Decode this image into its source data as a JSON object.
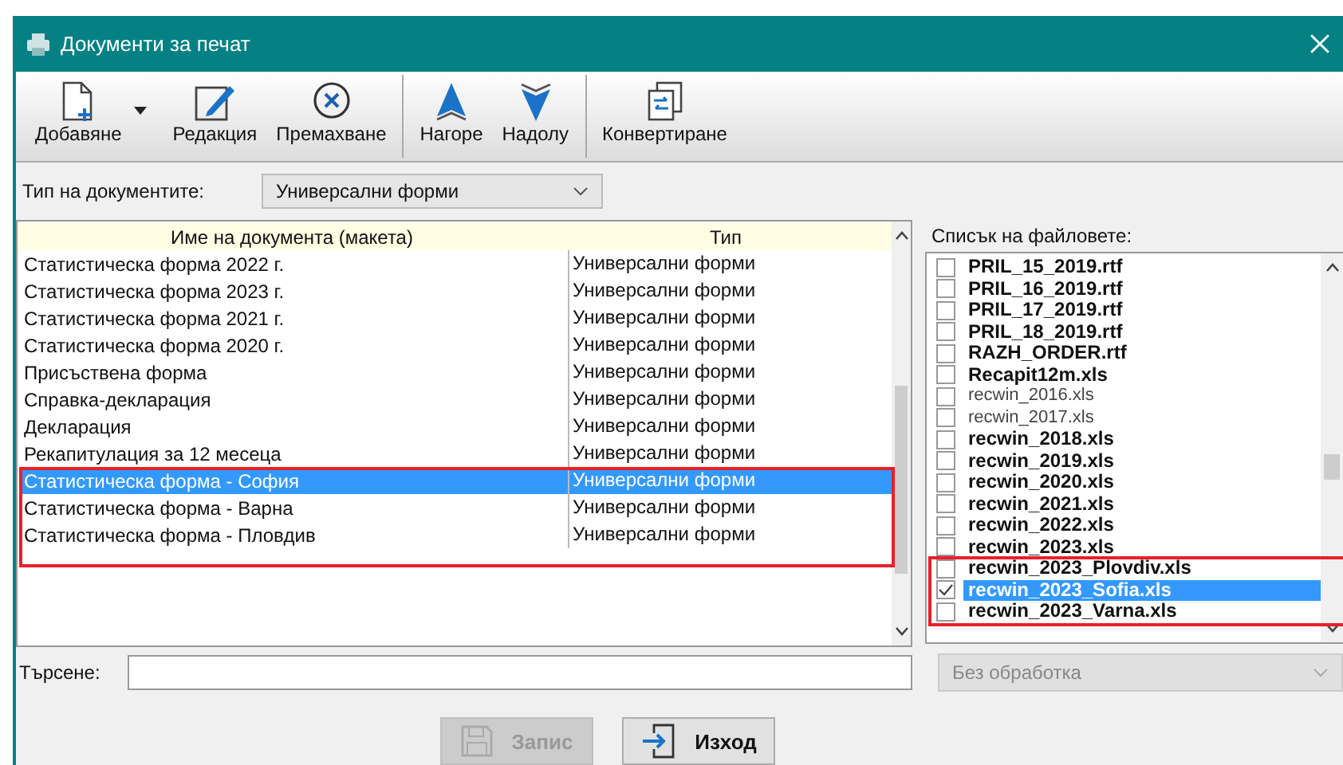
{
  "window": {
    "title": "Документи за печат"
  },
  "toolbar_groups": [
    [
      {
        "label": "Добавяне",
        "kind": "add",
        "dropdown": true
      },
      {
        "label": "Редакция",
        "kind": "edit",
        "dropdown": false
      },
      {
        "label": "Премахване",
        "kind": "remove",
        "dropdown": false
      }
    ],
    [
      {
        "label": "Нагоре",
        "kind": "up",
        "dropdown": false
      },
      {
        "label": "Надолу",
        "kind": "down",
        "dropdown": false
      }
    ],
    [
      {
        "label": "Конвертиране",
        "kind": "convert",
        "dropdown": false
      }
    ]
  ],
  "document_type": {
    "label": "Тип на документите:",
    "value": "Универсални форми"
  },
  "documents": {
    "columns": [
      "Име на документа (макета)",
      "Тип"
    ],
    "rows": [
      {
        "name": "Статистическа форма 2022 г.",
        "type": "Универсални форми",
        "selected": false,
        "highlighted": false
      },
      {
        "name": "Статистическа форма 2023 г.",
        "type": "Универсални форми",
        "selected": false,
        "highlighted": false
      },
      {
        "name": "Статистическа форма 2021 г.",
        "type": "Универсални форми",
        "selected": false,
        "highlighted": false
      },
      {
        "name": "Статистическа форма 2020 г.",
        "type": "Универсални форми",
        "selected": false,
        "highlighted": false
      },
      {
        "name": "Присъствена форма",
        "type": "Универсални форми",
        "selected": false,
        "highlighted": false
      },
      {
        "name": "Справка-декларация",
        "type": "Универсални форми",
        "selected": false,
        "highlighted": false
      },
      {
        "name": "Декларация",
        "type": "Универсални форми",
        "selected": false,
        "highlighted": false
      },
      {
        "name": "Рекапитулация за 12 месеца",
        "type": "Универсални форми",
        "selected": false,
        "highlighted": false
      },
      {
        "name": "Статистическа форма - София",
        "type": "Универсални форми",
        "selected": true,
        "highlighted": true
      },
      {
        "name": "Статистическа форма - Варна",
        "type": "Универсални форми",
        "selected": false,
        "highlighted": true
      },
      {
        "name": "Статистическа форма - Пловдив",
        "type": "Универсални форми",
        "selected": false,
        "highlighted": true
      }
    ]
  },
  "files": {
    "label": "Списък на файловете:",
    "items": [
      {
        "name": "PRIL_15_2019.rtf",
        "bold": true,
        "checked": false,
        "selected": false,
        "highlighted": false
      },
      {
        "name": "PRIL_16_2019.rtf",
        "bold": true,
        "checked": false,
        "selected": false,
        "highlighted": false
      },
      {
        "name": "PRIL_17_2019.rtf",
        "bold": true,
        "checked": false,
        "selected": false,
        "highlighted": false
      },
      {
        "name": "PRIL_18_2019.rtf",
        "bold": true,
        "checked": false,
        "selected": false,
        "highlighted": false
      },
      {
        "name": "RAZH_ORDER.rtf",
        "bold": true,
        "checked": false,
        "selected": false,
        "highlighted": false
      },
      {
        "name": "Recapit12m.xls",
        "bold": true,
        "checked": false,
        "selected": false,
        "highlighted": false
      },
      {
        "name": "recwin_2016.xls",
        "bold": false,
        "checked": false,
        "selected": false,
        "highlighted": false
      },
      {
        "name": "recwin_2017.xls",
        "bold": false,
        "checked": false,
        "selected": false,
        "highlighted": false
      },
      {
        "name": "recwin_2018.xls",
        "bold": true,
        "checked": false,
        "selected": false,
        "highlighted": false
      },
      {
        "name": "recwin_2019.xls",
        "bold": true,
        "checked": false,
        "selected": false,
        "highlighted": false
      },
      {
        "name": "recwin_2020.xls",
        "bold": true,
        "checked": false,
        "selected": false,
        "highlighted": false
      },
      {
        "name": "recwin_2021.xls",
        "bold": true,
        "checked": false,
        "selected": false,
        "highlighted": false
      },
      {
        "name": "recwin_2022.xls",
        "bold": true,
        "checked": false,
        "selected": false,
        "highlighted": false
      },
      {
        "name": "recwin_2023.xls",
        "bold": true,
        "checked": false,
        "selected": false,
        "highlighted": false
      },
      {
        "name": "recwin_2023_Plovdiv.xls",
        "bold": true,
        "checked": false,
        "selected": false,
        "highlighted": true
      },
      {
        "name": "recwin_2023_Sofia.xls",
        "bold": true,
        "checked": true,
        "selected": true,
        "highlighted": true
      },
      {
        "name": "recwin_2023_Varna.xls",
        "bold": true,
        "checked": false,
        "selected": false,
        "highlighted": true
      }
    ]
  },
  "search": {
    "label": "Търсене:"
  },
  "processing": {
    "value": "Без обработка",
    "disabled": true
  },
  "buttons": [
    {
      "label": "Запис",
      "kind": "save",
      "disabled": true
    },
    {
      "label": "Изход",
      "kind": "exit",
      "disabled": false
    }
  ]
}
